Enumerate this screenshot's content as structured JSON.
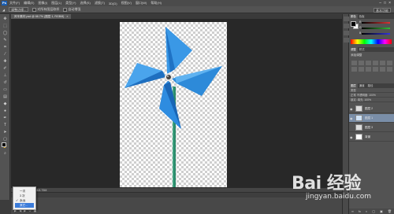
{
  "app": {
    "logo": "Ps"
  },
  "menubar": {
    "items": [
      "文件(F)",
      "编辑(E)",
      "图像(I)",
      "图层(L)",
      "类型(Y)",
      "选择(S)",
      "滤镜(T)",
      "3D(D)",
      "视图(V)",
      "窗口(W)",
      "帮助(H)"
    ],
    "controls": [
      "–",
      "□",
      "×"
    ]
  },
  "optionsbar": {
    "items": [
      "◢",
      "调整边缘...",
      "对所有图层取样",
      "自动增强"
    ],
    "workspace": "基本功能"
  },
  "document_tab": {
    "label": "风车素材.psd @ 66.7% (图层 1, RGB/8)",
    "close": "×"
  },
  "statusbar": {
    "text": "66.67%   文档:2.37M/4.75M"
  },
  "timeline": {
    "header": "时间轴",
    "popup": [
      {
        "label": "一次",
        "checked": false,
        "active": false
      },
      {
        "label": "3 次",
        "checked": false,
        "active": false
      },
      {
        "label": "永远",
        "checked": true,
        "active": false
      },
      {
        "label": "其它...",
        "checked": false,
        "active": true
      }
    ],
    "bottom_icons": [
      "▶",
      "◀",
      "▶",
      "↺",
      "▣"
    ]
  },
  "color_panel": {
    "tabs": [
      "颜色",
      "色板"
    ],
    "sliders": [
      {
        "label": "R",
        "color": "#d33"
      },
      {
        "label": "G",
        "color": "#3b3"
      },
      {
        "label": "B",
        "color": "#33d"
      }
    ]
  },
  "adjust_panel": {
    "tabs": [
      "调整",
      "样式"
    ],
    "title": "添加调整"
  },
  "layers_panel": {
    "tabs": [
      "图层",
      "通道",
      "路径"
    ],
    "kind_row": "类型",
    "mode_row": "正常   不透明度: 100%",
    "lock_row": "锁定:   填充: 100%",
    "layers": [
      {
        "name": "图层 2",
        "selected": false
      },
      {
        "name": "图层 1",
        "selected": true
      },
      {
        "name": "图层 3",
        "selected": false
      },
      {
        "name": "背景",
        "selected": false
      }
    ],
    "footer": [
      "∞",
      "fx",
      "◐",
      "▢",
      "▣",
      "🗑"
    ]
  },
  "watermark": {
    "brand": "Bai  经验",
    "url": "jingyan.baidu.com"
  },
  "colors": {
    "pinwheel_blue": "#2f8fe0",
    "pinwheel_dark": "#1565b8",
    "stick": "#2a8a6a",
    "selected_layer": "#7a8ea8"
  }
}
